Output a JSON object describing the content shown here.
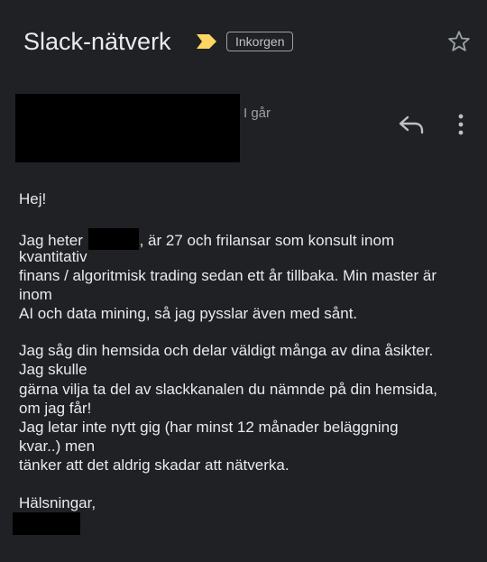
{
  "header": {
    "subject": "Slack-nätverk",
    "label": "Inkorgen"
  },
  "message": {
    "timestamp": "I går",
    "greeting": "Hej!",
    "p1": [
      {
        "before": "Jag heter ",
        "after": ", är 27 och frilansar som konsult inom"
      },
      "kvantitativ",
      "finans / algoritmisk trading sedan ett år tillbaka. Min master är",
      "inom",
      "AI och data mining, så jag pysslar även med sånt."
    ],
    "p2": [
      "Jag såg din hemsida och delar väldigt många av dina åsikter.",
      "Jag skulle",
      "gärna vilja ta del av slackkanalen du nämnde på din hemsida,",
      "om jag får!",
      "Jag letar inte nytt gig (har minst 12 månader beläggning",
      "kvar..) men",
      "tänker att det aldrig skadar att nätverka."
    ],
    "closing": "Hälsningar,"
  },
  "colors": {
    "background": "#202124",
    "text": "#e8eaed",
    "secondary_text": "#9aa0a6",
    "importance_marker": "#fdd663"
  },
  "icons": {
    "importance": "importance-marker-icon",
    "star": "star-icon",
    "reply": "reply-icon",
    "more": "more-vert-icon"
  }
}
